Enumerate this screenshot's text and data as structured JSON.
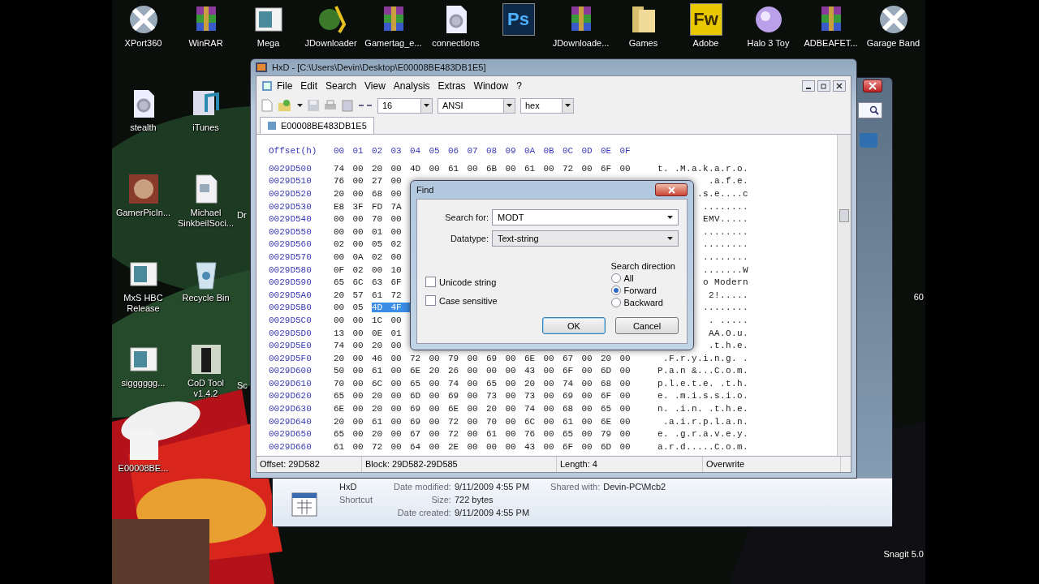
{
  "desktop": {
    "top_icons": [
      {
        "label": "XPort360",
        "kind": "xbox"
      },
      {
        "label": "WinRAR",
        "kind": "archive"
      },
      {
        "label": "Mega",
        "kind": "app-window"
      },
      {
        "label": "JDownloader",
        "kind": "globe"
      },
      {
        "label": "Gamertag_e...",
        "kind": "archive"
      },
      {
        "label": "connections",
        "kind": "gear-doc"
      },
      {
        "kind": "ps",
        "glyph": "Ps"
      },
      {
        "label": "JDownloade...",
        "kind": "archive"
      },
      {
        "label": "Games",
        "kind": "folder"
      },
      {
        "label": "Adobe",
        "kind": "fw",
        "glyph": "Fw"
      },
      {
        "label": "Halo 3 Toy",
        "kind": "orb"
      },
      {
        "label": "ADBEAFET...",
        "kind": "archive"
      },
      {
        "label": "Garage Band",
        "kind": "xbox"
      }
    ],
    "left_rows": [
      {
        "icons": [
          {
            "label": "stealth",
            "kind": "gear-doc"
          },
          {
            "label": "iTunes",
            "kind": "music"
          }
        ]
      },
      {
        "icons": [
          {
            "label": "GamerPicIn...",
            "kind": "face-tile"
          },
          {
            "label": "Michael SinkbeilSoci...",
            "kind": "document"
          }
        ],
        "hidden_label": "Dr"
      },
      {
        "icons": [
          {
            "label": "MxS HBC Release",
            "kind": "app-window"
          },
          {
            "label": "Recycle Bin",
            "kind": "recycle"
          }
        ]
      },
      {
        "icons": [
          {
            "label": "sigggggg...",
            "kind": "app-window"
          },
          {
            "label": "CoD Tool v1.4.2",
            "kind": "dark-tile"
          }
        ],
        "hidden_label": "Sc"
      },
      {
        "icons": [
          {
            "label": "E00008BE...",
            "kind": "blank-doc"
          }
        ]
      }
    ],
    "right_labels": [
      {
        "label": "60"
      },
      {
        "label": "Snagit 5.0"
      }
    ]
  },
  "explorer": {
    "details": {
      "name": "HxD",
      "type": "Shortcut",
      "fields": [
        {
          "label": "Date modified:",
          "value": "9/11/2009 4:55 PM"
        },
        {
          "label": "Size:",
          "value": "722 bytes"
        },
        {
          "label": "Date created:",
          "value": "9/11/2009 4:55 PM"
        }
      ],
      "shared": {
        "label": "Shared with:",
        "value": "Devin-PC\\Mcb2"
      }
    }
  },
  "hxd": {
    "title": "HxD - [C:\\Users\\Devin\\Desktop\\E00008BE483DB1E5]",
    "menu": [
      "File",
      "Edit",
      "Search",
      "View",
      "Analysis",
      "Extras",
      "Window",
      "?"
    ],
    "toolbar": {
      "columns": "16",
      "charset": "ANSI",
      "base": "hex"
    },
    "tab": {
      "label": "E00008BE483DB1E5",
      "selected": true
    },
    "header": {
      "offset": "Offset(h)",
      "columns": [
        "00",
        "01",
        "02",
        "03",
        "04",
        "05",
        "06",
        "07",
        "08",
        "09",
        "0A",
        "0B",
        "0C",
        "0D",
        "0E",
        "0F"
      ]
    },
    "rows": [
      {
        "offset": "0029D500",
        "bytes": [
          "74",
          "00",
          "20",
          "00",
          "4D",
          "00",
          "61",
          "00",
          "6B",
          "00",
          "61",
          "00",
          "72",
          "00",
          "6F",
          "00"
        ],
        "ascii": "t. .M.a.k.a.r.o."
      },
      {
        "offset": "0029D510",
        "bytes": [
          "76",
          "00",
          "27",
          "00"
        ],
        "ascii": ".a.f.e."
      },
      {
        "offset": "0029D520",
        "bytes": [
          "20",
          "00",
          "68",
          "00"
        ],
        "ascii": ".s.e....c"
      },
      {
        "offset": "0029D530",
        "bytes": [
          "E8",
          "3F",
          "FD",
          "7A"
        ],
        "ascii": "........"
      },
      {
        "offset": "0029D540",
        "bytes": [
          "00",
          "00",
          "70",
          "00"
        ],
        "ascii": "EMV....."
      },
      {
        "offset": "0029D550",
        "bytes": [
          "00",
          "00",
          "01",
          "00"
        ],
        "ascii": "........"
      },
      {
        "offset": "0029D560",
        "bytes": [
          "02",
          "00",
          "05",
          "02"
        ],
        "ascii": "........"
      },
      {
        "offset": "0029D570",
        "bytes": [
          "00",
          "0A",
          "02",
          "00"
        ],
        "ascii": "........"
      },
      {
        "offset": "0029D580",
        "bytes": [
          "0F",
          "02",
          "00",
          "10"
        ],
        "ascii": ".......W"
      },
      {
        "offset": "0029D590",
        "bytes": [
          "65",
          "6C",
          "63",
          "6F"
        ],
        "ascii": "o Modern"
      },
      {
        "offset": "0029D5A0",
        "bytes": [
          "20",
          "57",
          "61",
          "72"
        ],
        "ascii": "2!....."
      },
      {
        "offset": "0029D5B0",
        "bytes": [
          "00",
          "05"
        ],
        "selected_bytes": [
          "4D",
          "4F"
        ],
        "ascii": "........"
      },
      {
        "offset": "0029D5C0",
        "bytes": [
          "00",
          "00",
          "1C",
          "00"
        ],
        "ascii": ". ....."
      },
      {
        "offset": "0029D5D0",
        "bytes": [
          "13",
          "00",
          "0E",
          "01"
        ],
        "ascii": "AA.O.u."
      },
      {
        "offset": "0029D5E0",
        "bytes": [
          "74",
          "00",
          "20",
          "00"
        ],
        "ascii": ".t.h.e."
      },
      {
        "offset": "0029D5F0",
        "bytes": [
          "20",
          "00",
          "46",
          "00",
          "72",
          "00",
          "79",
          "00",
          "69",
          "00",
          "6E",
          "00",
          "67",
          "00",
          "20",
          "00"
        ],
        "ascii": ".F.r.y.i.n.g. ."
      },
      {
        "offset": "0029D600",
        "bytes": [
          "50",
          "00",
          "61",
          "00",
          "6E",
          "20",
          "26",
          "00",
          "00",
          "00",
          "43",
          "00",
          "6F",
          "00",
          "6D",
          "00"
        ],
        "ascii": "P.a.n &...C.o.m."
      },
      {
        "offset": "0029D610",
        "bytes": [
          "70",
          "00",
          "6C",
          "00",
          "65",
          "00",
          "74",
          "00",
          "65",
          "00",
          "20",
          "00",
          "74",
          "00",
          "68",
          "00"
        ],
        "ascii": "p.l.e.t.e. .t.h."
      },
      {
        "offset": "0029D620",
        "bytes": [
          "65",
          "00",
          "20",
          "00",
          "6D",
          "00",
          "69",
          "00",
          "73",
          "00",
          "73",
          "00",
          "69",
          "00",
          "6F",
          "00"
        ],
        "ascii": "e. .m.i.s.s.i.o."
      },
      {
        "offset": "0029D630",
        "bytes": [
          "6E",
          "00",
          "20",
          "00",
          "69",
          "00",
          "6E",
          "00",
          "20",
          "00",
          "74",
          "00",
          "68",
          "00",
          "65",
          "00"
        ],
        "ascii": "n. .i.n. .t.h.e."
      },
      {
        "offset": "0029D640",
        "bytes": [
          "20",
          "00",
          "61",
          "00",
          "69",
          "00",
          "72",
          "00",
          "70",
          "00",
          "6C",
          "00",
          "61",
          "00",
          "6E",
          "00"
        ],
        "ascii": " .a.i.r.p.l.a.n."
      },
      {
        "offset": "0029D650",
        "bytes": [
          "65",
          "00",
          "20",
          "00",
          "67",
          "00",
          "72",
          "00",
          "61",
          "00",
          "76",
          "00",
          "65",
          "00",
          "79",
          "00"
        ],
        "ascii": "e. .g.r.a.v.e.y."
      },
      {
        "offset": "0029D660",
        "bytes": [
          "61",
          "00",
          "72",
          "00",
          "64",
          "00",
          "2E",
          "00",
          "00",
          "00",
          "43",
          "00",
          "6F",
          "00",
          "6D",
          "00"
        ],
        "ascii": "a.r.d.....C.o.m."
      }
    ],
    "status": [
      "Offset: 29D582",
      "Block: 29D582-29D585",
      "Length: 4",
      "Overwrite"
    ]
  },
  "find_dialog": {
    "title": "Find",
    "search_label": "Search for:",
    "search_value": "MODT",
    "datatype_label": "Datatype:",
    "datatype_value": "Text-string",
    "checkboxes": [
      {
        "label": "Unicode string",
        "checked": false
      },
      {
        "label": "Case sensitive",
        "checked": false
      }
    ],
    "direction_label": "Search direction",
    "directions": [
      {
        "label": "All",
        "selected": false
      },
      {
        "label": "Forward",
        "selected": true
      },
      {
        "label": "Backward",
        "selected": false
      }
    ],
    "buttons": [
      {
        "label": "OK",
        "kind": "default"
      },
      {
        "label": "Cancel",
        "kind": "normal"
      }
    ]
  }
}
